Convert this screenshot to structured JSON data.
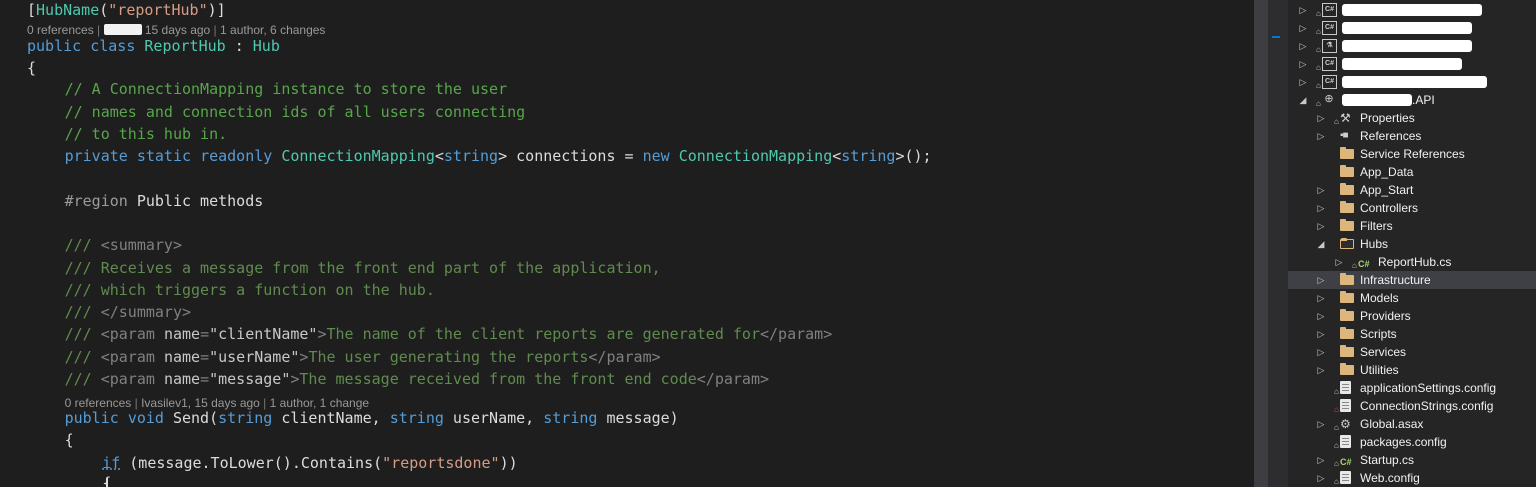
{
  "editor": {
    "lines": [
      {
        "t": 3,
        "indent": 0,
        "segs": [
          {
            "c": "pt",
            "v": "["
          },
          {
            "c": "ty",
            "v": "HubName"
          },
          {
            "c": "pt",
            "v": "("
          },
          {
            "c": "str",
            "v": "\"reportHub\""
          },
          {
            "c": "pt",
            "v": ")]"
          }
        ]
      },
      {
        "t": 39,
        "indent": 0,
        "segs": [
          {
            "c": "kw",
            "v": "public"
          },
          {
            "c": "pt",
            "v": " "
          },
          {
            "c": "kw",
            "v": "class"
          },
          {
            "c": "pt",
            "v": " "
          },
          {
            "c": "ty",
            "v": "ReportHub"
          },
          {
            "c": "pt",
            "v": " : "
          },
          {
            "c": "ty",
            "v": "Hub"
          }
        ]
      },
      {
        "t": 61,
        "indent": 0,
        "segs": [
          {
            "c": "pt",
            "v": "{"
          }
        ]
      },
      {
        "t": 82,
        "indent": 1,
        "segs": [
          {
            "c": "cm",
            "v": "// A ConnectionMapping instance to store the user"
          }
        ]
      },
      {
        "t": 105,
        "indent": 1,
        "segs": [
          {
            "c": "cm",
            "v": "// names and connection ids of all users connecting"
          }
        ]
      },
      {
        "t": 127,
        "indent": 1,
        "segs": [
          {
            "c": "cm",
            "v": "// to this hub in."
          }
        ]
      },
      {
        "t": 149,
        "indent": 1,
        "segs": [
          {
            "c": "kw",
            "v": "private"
          },
          {
            "c": "pt",
            "v": " "
          },
          {
            "c": "kw",
            "v": "static"
          },
          {
            "c": "pt",
            "v": " "
          },
          {
            "c": "kw",
            "v": "readonly"
          },
          {
            "c": "pt",
            "v": " "
          },
          {
            "c": "ty",
            "v": "ConnectionMapping"
          },
          {
            "c": "pt",
            "v": "<"
          },
          {
            "c": "kw",
            "v": "string"
          },
          {
            "c": "pt",
            "v": "> connections = "
          },
          {
            "c": "kw",
            "v": "new"
          },
          {
            "c": "pt",
            "v": " "
          },
          {
            "c": "ty",
            "v": "ConnectionMapping"
          },
          {
            "c": "pt",
            "v": "<"
          },
          {
            "c": "kw",
            "v": "string"
          },
          {
            "c": "pt",
            "v": ">();"
          }
        ]
      },
      {
        "t": 194,
        "indent": 1,
        "segs": [
          {
            "c": "pp",
            "v": "#region"
          },
          {
            "c": "pt",
            "v": " Public methods"
          }
        ]
      },
      {
        "t": 238,
        "indent": 1,
        "segs": [
          {
            "c": "xd",
            "v": "/// "
          },
          {
            "c": "xt",
            "v": "<summary>"
          }
        ]
      },
      {
        "t": 261,
        "indent": 1,
        "segs": [
          {
            "c": "xd",
            "v": "/// Receives a message from the front end part of the application,"
          }
        ]
      },
      {
        "t": 283,
        "indent": 1,
        "segs": [
          {
            "c": "xd",
            "v": "/// which triggers a function on the hub."
          }
        ]
      },
      {
        "t": 305,
        "indent": 1,
        "segs": [
          {
            "c": "xd",
            "v": "/// "
          },
          {
            "c": "xt",
            "v": "</summary>"
          }
        ]
      },
      {
        "t": 327,
        "indent": 1,
        "segs": [
          {
            "c": "xd",
            "v": "/// "
          },
          {
            "c": "xt",
            "v": "<param "
          },
          {
            "c": "xa",
            "v": "name"
          },
          {
            "c": "xt",
            "v": "="
          },
          {
            "c": "xs",
            "v": "\"clientName\""
          },
          {
            "c": "xt",
            "v": ">"
          },
          {
            "c": "xd",
            "v": "The name of the client reports are generated for"
          },
          {
            "c": "xt",
            "v": "</param>"
          }
        ]
      },
      {
        "t": 350,
        "indent": 1,
        "segs": [
          {
            "c": "xd",
            "v": "/// "
          },
          {
            "c": "xt",
            "v": "<param "
          },
          {
            "c": "xa",
            "v": "name"
          },
          {
            "c": "xt",
            "v": "="
          },
          {
            "c": "xs",
            "v": "\"userName\""
          },
          {
            "c": "xt",
            "v": ">"
          },
          {
            "c": "xd",
            "v": "The user generating the reports"
          },
          {
            "c": "xt",
            "v": "</param>"
          }
        ]
      },
      {
        "t": 372,
        "indent": 1,
        "segs": [
          {
            "c": "xd",
            "v": "/// "
          },
          {
            "c": "xt",
            "v": "<param "
          },
          {
            "c": "xa",
            "v": "name"
          },
          {
            "c": "xt",
            "v": "="
          },
          {
            "c": "xs",
            "v": "\"message\""
          },
          {
            "c": "xt",
            "v": ">"
          },
          {
            "c": "xd",
            "v": "The message received from the front end code"
          },
          {
            "c": "xt",
            "v": "</param>"
          }
        ]
      },
      {
        "t": 411,
        "indent": 1,
        "segs": [
          {
            "c": "kw",
            "v": "public"
          },
          {
            "c": "pt",
            "v": " "
          },
          {
            "c": "kw",
            "v": "void"
          },
          {
            "c": "pt",
            "v": " Send("
          },
          {
            "c": "kw",
            "v": "string"
          },
          {
            "c": "pt",
            "v": " clientName, "
          },
          {
            "c": "kw",
            "v": "string"
          },
          {
            "c": "pt",
            "v": " userName, "
          },
          {
            "c": "kw",
            "v": "string"
          },
          {
            "c": "pt",
            "v": " message)"
          }
        ]
      },
      {
        "t": 433,
        "indent": 1,
        "segs": [
          {
            "c": "pt",
            "v": "{"
          }
        ]
      },
      {
        "t": 456,
        "indent": 2,
        "segs": [
          {
            "c": "ctl",
            "v": "if"
          },
          {
            "c": "pt",
            "v": " (message.ToLower().Contains("
          },
          {
            "c": "str",
            "v": "\"reportsdone\""
          },
          {
            "c": "pt",
            "v": "))"
          }
        ]
      },
      {
        "t": 476,
        "indent": 2,
        "segs": [
          {
            "c": "pt",
            "v": "{"
          }
        ]
      }
    ],
    "lens": [
      {
        "t": 22,
        "indent": 0,
        "refs": "0 references",
        "author_suffix": " 15 days ago",
        "redacted_author": true,
        "changes": "1 author, 6 changes"
      },
      {
        "t": 395,
        "indent": 1,
        "refs": "0 references",
        "author_suffix": "Ivasilev1, 15 days ago",
        "redacted_author": false,
        "changes": "1 author, 1 change"
      }
    ]
  },
  "solution_explorer": {
    "items": [
      {
        "t": 3,
        "lvl": 0,
        "icon": "csproj",
        "label": "",
        "redacted": true,
        "expand": "collapsed",
        "lock": true
      },
      {
        "t": 21,
        "lvl": 0,
        "icon": "csproj",
        "label": "",
        "redacted": true,
        "expand": "collapsed",
        "lock": true
      },
      {
        "t": 39,
        "lvl": 0,
        "icon": "testproj",
        "label": "",
        "redacted": true,
        "expand": "collapsed",
        "lock": true
      },
      {
        "t": 57,
        "lvl": 0,
        "icon": "csproj",
        "label": "",
        "redacted": true,
        "expand": "collapsed",
        "lock": true
      },
      {
        "t": 75,
        "lvl": 0,
        "icon": "csproj",
        "label": "",
        "redacted": true,
        "expand": "collapsed",
        "lock": true
      },
      {
        "t": 93,
        "lvl": 0,
        "icon": "webproj",
        "label": ".API",
        "redacted": true,
        "expand": "expanded",
        "lock": true
      },
      {
        "t": 111,
        "lvl": 1,
        "icon": "wrench",
        "label": "Properties",
        "expand": "collapsed",
        "lock": true
      },
      {
        "t": 129,
        "lvl": 1,
        "icon": "refs",
        "label": "References",
        "expand": "collapsed",
        "lock": false
      },
      {
        "t": 147,
        "lvl": 1,
        "icon": "folder",
        "label": "Service References",
        "expand": "none",
        "lock": false
      },
      {
        "t": 165,
        "lvl": 1,
        "icon": "folder",
        "label": "App_Data",
        "expand": "none",
        "lock": false
      },
      {
        "t": 183,
        "lvl": 1,
        "icon": "folder",
        "label": "App_Start",
        "expand": "collapsed",
        "lock": false
      },
      {
        "t": 201,
        "lvl": 1,
        "icon": "folder",
        "label": "Controllers",
        "expand": "collapsed",
        "lock": false
      },
      {
        "t": 219,
        "lvl": 1,
        "icon": "folder",
        "label": "Filters",
        "expand": "collapsed",
        "lock": false
      },
      {
        "t": 237,
        "lvl": 1,
        "icon": "folder-open",
        "label": "Hubs",
        "expand": "expanded",
        "lock": false
      },
      {
        "t": 255,
        "lvl": 2,
        "icon": "csfile",
        "label": "ReportHub.cs",
        "expand": "collapsed",
        "lock": true
      },
      {
        "t": 273,
        "lvl": 1,
        "icon": "folder",
        "label": "Infrastructure",
        "expand": "collapsed",
        "lock": false,
        "selected": true
      },
      {
        "t": 291,
        "lvl": 1,
        "icon": "folder",
        "label": "Models",
        "expand": "collapsed",
        "lock": false
      },
      {
        "t": 309,
        "lvl": 1,
        "icon": "folder",
        "label": "Providers",
        "expand": "collapsed",
        "lock": false
      },
      {
        "t": 327,
        "lvl": 1,
        "icon": "folder",
        "label": "Scripts",
        "expand": "collapsed",
        "lock": false
      },
      {
        "t": 345,
        "lvl": 1,
        "icon": "folder",
        "label": "Services",
        "expand": "collapsed",
        "lock": false
      },
      {
        "t": 363,
        "lvl": 1,
        "icon": "folder",
        "label": "Utilities",
        "expand": "collapsed",
        "lock": false
      },
      {
        "t": 381,
        "lvl": 1,
        "icon": "config",
        "label": "applicationSettings.config",
        "expand": "none",
        "lock": true
      },
      {
        "t": 399,
        "lvl": 1,
        "icon": "config",
        "label": "ConnectionStrings.config",
        "expand": "none",
        "lock": true,
        "lock_color": "#e05050"
      },
      {
        "t": 417,
        "lvl": 1,
        "icon": "asax",
        "label": "Global.asax",
        "expand": "collapsed",
        "lock": true
      },
      {
        "t": 435,
        "lvl": 1,
        "icon": "config",
        "label": "packages.config",
        "expand": "none",
        "lock": true
      },
      {
        "t": 453,
        "lvl": 1,
        "icon": "csfile",
        "label": "Startup.cs",
        "expand": "collapsed",
        "lock": true
      },
      {
        "t": 471,
        "lvl": 1,
        "icon": "config",
        "label": "Web.config",
        "expand": "collapsed",
        "lock": true
      }
    ]
  }
}
